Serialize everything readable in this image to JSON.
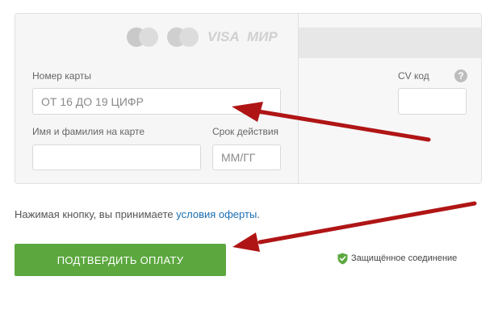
{
  "card_form": {
    "brands": [
      "VISA",
      "МИР"
    ],
    "card_number": {
      "label": "Номер карты",
      "placeholder": "ОТ 16 ДО 19 ЦИФР"
    },
    "cardholder": {
      "label": "Имя и фамилия на карте",
      "placeholder": ""
    },
    "expiry": {
      "label": "Срок действия",
      "placeholder": "ММ/ГГ"
    },
    "cvv": {
      "label": "CV код",
      "placeholder": "",
      "help_glyph": "?"
    }
  },
  "terms": {
    "prefix": "Нажимая кнопку, вы принимаете ",
    "link": "условия оферты",
    "suffix": "."
  },
  "submit_label": "ПОДТВЕРДИТЬ ОПЛАТУ",
  "secure_label": "Защищённое соединение",
  "colors": {
    "button": "#5ca83f",
    "link": "#1b6fb3",
    "arrow": "#b01515",
    "shield": "#5ca83f"
  },
  "icons": [
    "mastercard-logo-icon",
    "maestro-logo-icon",
    "visa-logo-icon",
    "mir-logo-icon",
    "help-icon",
    "shield-check-icon",
    "arrow-annotation-icon"
  ]
}
